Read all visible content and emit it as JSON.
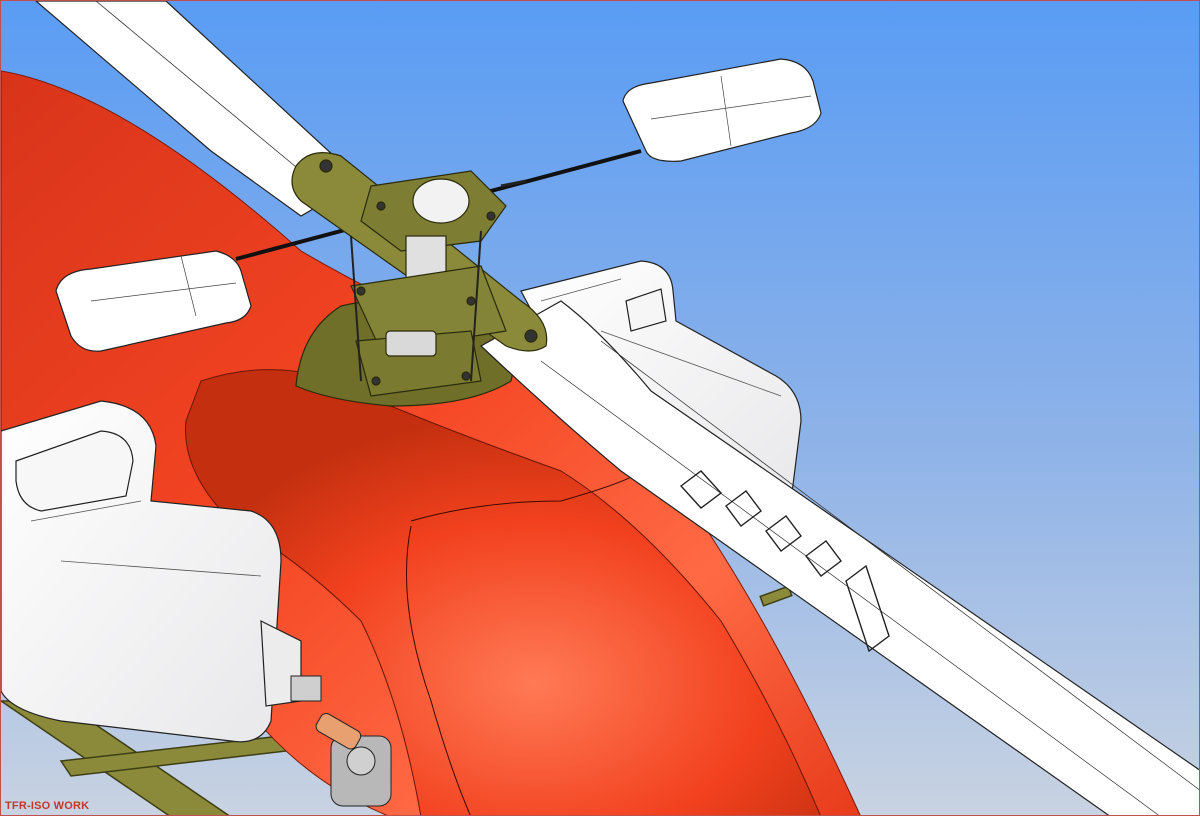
{
  "viewport": {
    "view_label": "TFR-ISO WORK"
  },
  "scene": {
    "subject": "rc-helicopter-model",
    "colors": {
      "sky_top": "#5a9cf4",
      "sky_bottom": "#c8d4e4",
      "canopy": "#f0401e",
      "canopy_highlight": "#ff6a45",
      "canopy_shadow": "#b82a10",
      "blade": "#ffffff",
      "blade_line": "#222222",
      "mechanics": "#8a8a3a",
      "mechanics_dark": "#4d4d1e",
      "frame_border": "#c0504d"
    }
  }
}
